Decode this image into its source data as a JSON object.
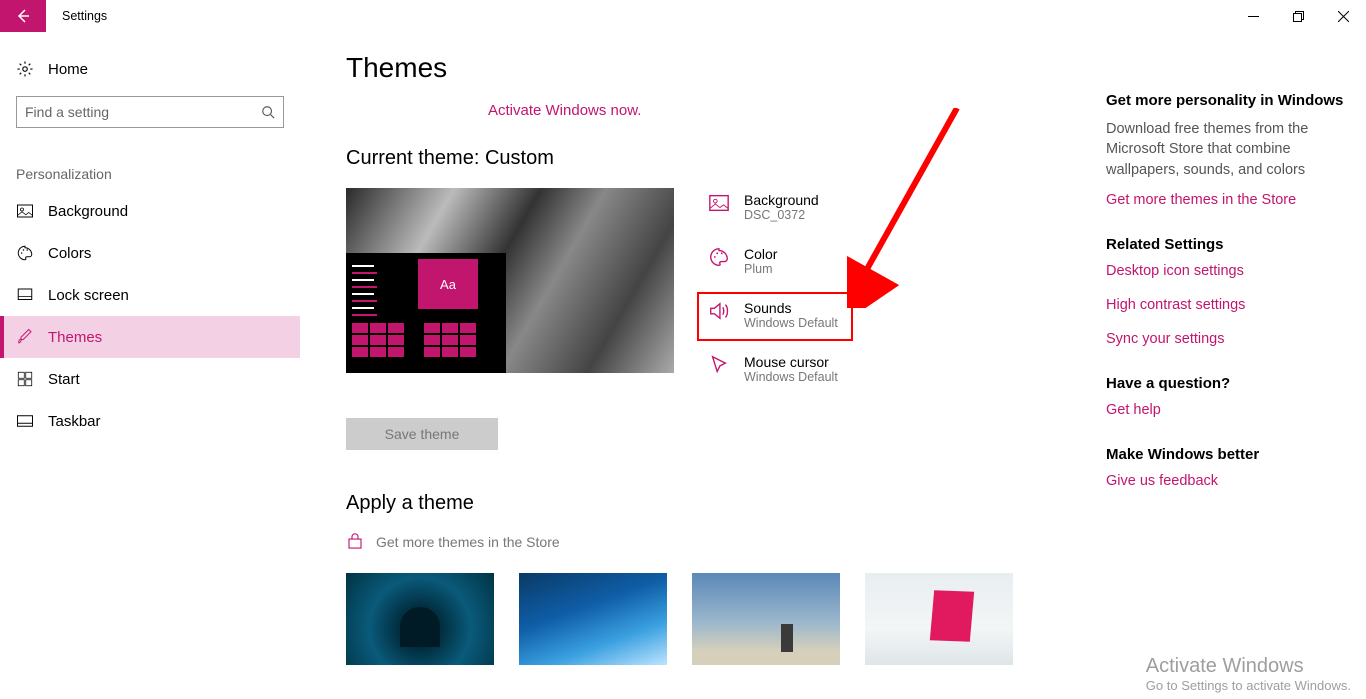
{
  "app": {
    "title": "Settings"
  },
  "sidebar": {
    "home": "Home",
    "search_placeholder": "Find a setting",
    "section": "Personalization",
    "items": [
      {
        "label": "Background"
      },
      {
        "label": "Colors"
      },
      {
        "label": "Lock screen"
      },
      {
        "label": "Themes"
      },
      {
        "label": "Start"
      },
      {
        "label": "Taskbar"
      }
    ]
  },
  "main": {
    "title": "Themes",
    "activate": "Activate Windows now.",
    "current_heading": "Current theme: Custom",
    "preview_tile_text": "Aa",
    "settings": [
      {
        "title": "Background",
        "sub": "DSC_0372"
      },
      {
        "title": "Color",
        "sub": "Plum"
      },
      {
        "title": "Sounds",
        "sub": "Windows Default"
      },
      {
        "title": "Mouse cursor",
        "sub": "Windows Default"
      }
    ],
    "save_btn": "Save theme",
    "apply_heading": "Apply a theme",
    "store_link": "Get more themes in the Store"
  },
  "right": {
    "h1": "Get more personality in Windows",
    "p1": "Download free themes from the Microsoft Store that combine wallpapers, sounds, and colors",
    "l1": "Get more themes in the Store",
    "h2": "Related Settings",
    "l2": "Desktop icon settings",
    "l3": "High contrast settings",
    "l4": "Sync your settings",
    "h3": "Have a question?",
    "l5": "Get help",
    "h4": "Make Windows better",
    "l6": "Give us feedback"
  },
  "watermark": {
    "title": "Activate Windows",
    "sub": "Go to Settings to activate Windows."
  }
}
